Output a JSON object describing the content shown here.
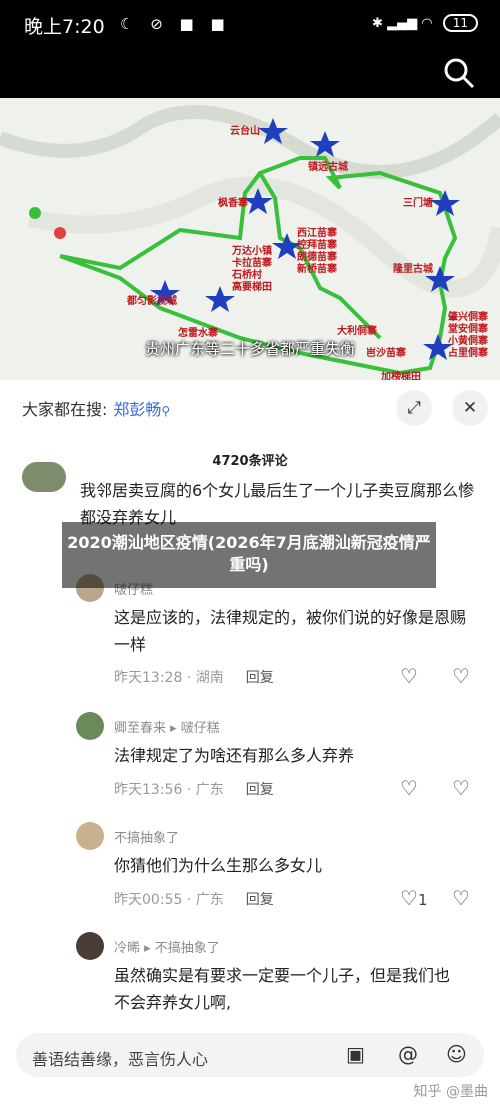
{
  "status_bar": {
    "time": "晚上7:20",
    "battery": "11"
  },
  "map": {
    "caption": "贵州广东等二十多省都严重失衡",
    "labels": [
      "云台山",
      "镇远古城",
      "三门塘",
      "枫香寨",
      "西江苗寨",
      "控拜苗寨",
      "朗德苗寨",
      "新桥苗寨",
      "隆里古城",
      "万达小镇",
      "卡拉苗寨",
      "石桥村",
      "高要梯田",
      "都匀影视城",
      "怎雷水寨",
      "大利侗寨",
      "岜沙苗寨",
      "加榜梯田",
      "肇兴侗寨",
      "堂安侗寨",
      "小黄侗寨",
      "占里侗寨"
    ]
  },
  "sheet": {
    "hot_prefix": "大家都在搜:",
    "hot_keyword": "郑彭畅",
    "comment_count": "4720条评论"
  },
  "overlay_title": "2020潮汕地区疫情(2026年7月底潮汕新冠疫情严重吗)",
  "comments": [
    {
      "name": "",
      "text": "我邻居卖豆腐的6个女儿最后生了一个儿子卖豆腐那么惨都没弃养女儿",
      "time": "",
      "location": "",
      "reply": ""
    },
    {
      "name": "啵仔糕",
      "text": "这是应该的，法律规定的，被你们说的好像是恩赐一样",
      "time": "昨天13:28",
      "location": "湖南",
      "reply": "回复"
    },
    {
      "name": "卿至春来  ▸  啵仔糕",
      "text": "法律规定了为啥还有那么多人弃养",
      "time": "昨天13:56",
      "location": "广东",
      "reply": "回复"
    },
    {
      "name": "不搞抽象了",
      "text": "你猜他们为什么生那么多女儿",
      "time": "昨天00:55",
      "location": "广东",
      "reply": "回复",
      "likes": "1"
    },
    {
      "name": "冷晞  ▸  不搞抽象了",
      "text": "虽然确实是有要求一定要一个儿子，但是我们也不会弃养女儿啊,",
      "time": "",
      "location": "",
      "reply": ""
    }
  ],
  "input": {
    "placeholder": "善语结善缘，恶言伤人心"
  },
  "watermark": "知乎 @墨曲"
}
